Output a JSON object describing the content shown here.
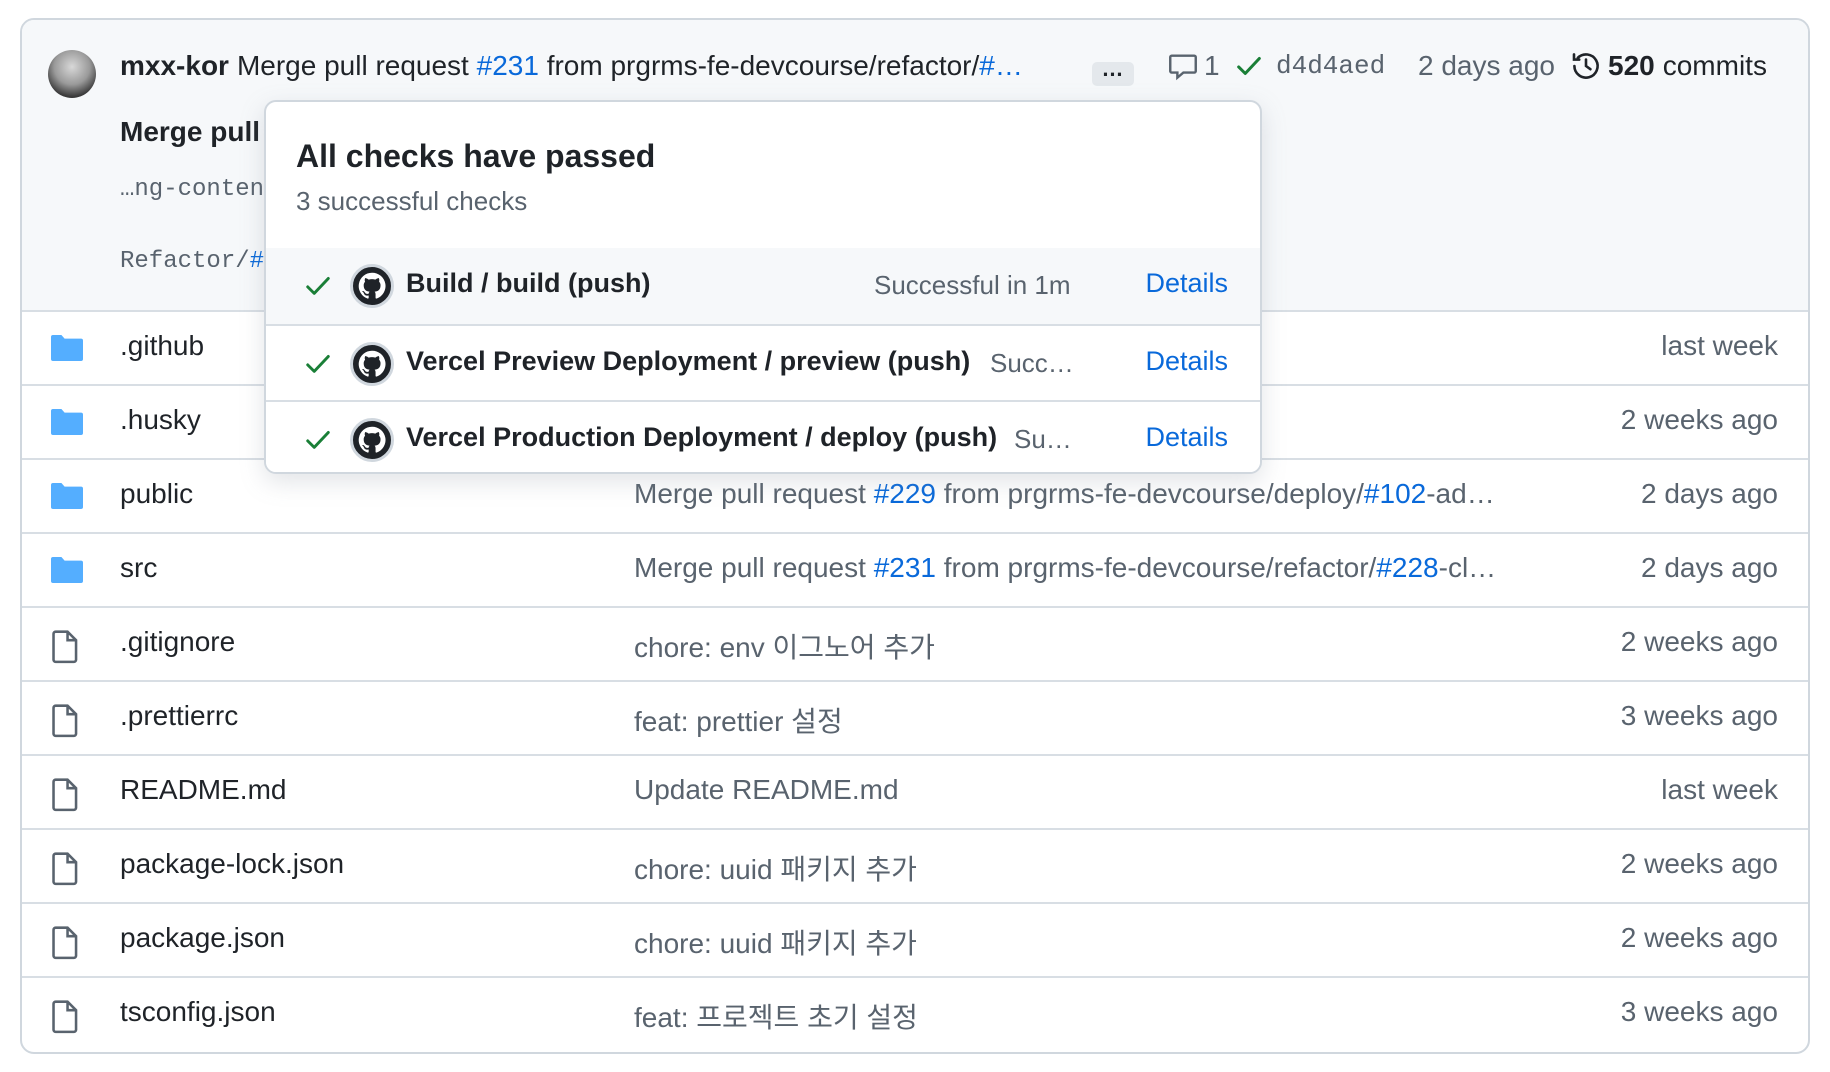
{
  "commit": {
    "author": "mxx-kor",
    "message_prefix": "Merge pull request",
    "pr_ref": "#231",
    "message_mid": "from prgrms-fe-devcourse/refactor/",
    "message_tail_link": "#…",
    "ellipsis": "…",
    "comments": "1",
    "sha": "d4d4aed",
    "time": "2 days ago",
    "commits_count": "520",
    "commits_label": "commits",
    "body_title": "Merge pull",
    "body_line1": "…ng-conten",
    "body_line2_prefix": "Refactor/",
    "body_line2_link": "#"
  },
  "popover": {
    "title": "All checks have passed",
    "subtitle": "3 successful checks",
    "checks": [
      {
        "name": "Build / build (push)",
        "status": "Successful in 1m",
        "details": "Details"
      },
      {
        "name": "Vercel Preview Deployment / preview (push)",
        "status": "Succ…",
        "details": "Details"
      },
      {
        "name": "Vercel Production Deployment / deploy (push)",
        "status": "Su…",
        "details": "Details"
      }
    ]
  },
  "files": [
    {
      "type": "folder",
      "name": ".github",
      "message": "",
      "time": "last week"
    },
    {
      "type": "folder",
      "name": ".husky",
      "message": "",
      "time": "2 weeks ago"
    },
    {
      "type": "folder",
      "name": "public",
      "msg_a": "Merge pull request ",
      "msg_link1": "#229",
      "msg_b": " from prgrms-fe-devcourse/deploy/",
      "msg_link2": "#102",
      "msg_c": "-ad…",
      "time": "2 days ago"
    },
    {
      "type": "folder",
      "name": "src",
      "msg_a": "Merge pull request ",
      "msg_link1": "#231",
      "msg_b": " from prgrms-fe-devcourse/refactor/",
      "msg_link2": "#228",
      "msg_c": "-cl…",
      "time": "2 days ago"
    },
    {
      "type": "file",
      "name": ".gitignore",
      "message": "chore: env 이그노어 추가",
      "time": "2 weeks ago"
    },
    {
      "type": "file",
      "name": ".prettierrc",
      "message": "feat: prettier 설정",
      "time": "3 weeks ago"
    },
    {
      "type": "file",
      "name": "README.md",
      "message": "Update README.md",
      "time": "last week"
    },
    {
      "type": "file",
      "name": "package-lock.json",
      "message": "chore: uuid 패키지 추가",
      "time": "2 weeks ago"
    },
    {
      "type": "file",
      "name": "package.json",
      "message": "chore: uuid 패키지 추가",
      "time": "2 weeks ago"
    },
    {
      "type": "file",
      "name": "tsconfig.json",
      "message": "feat: 프로젝트 초기 설정",
      "time": "3 weeks ago"
    }
  ],
  "colors": {
    "link": "#0969da",
    "success": "#1a7f37",
    "folder": "#54aeff",
    "muted": "#59636e"
  }
}
